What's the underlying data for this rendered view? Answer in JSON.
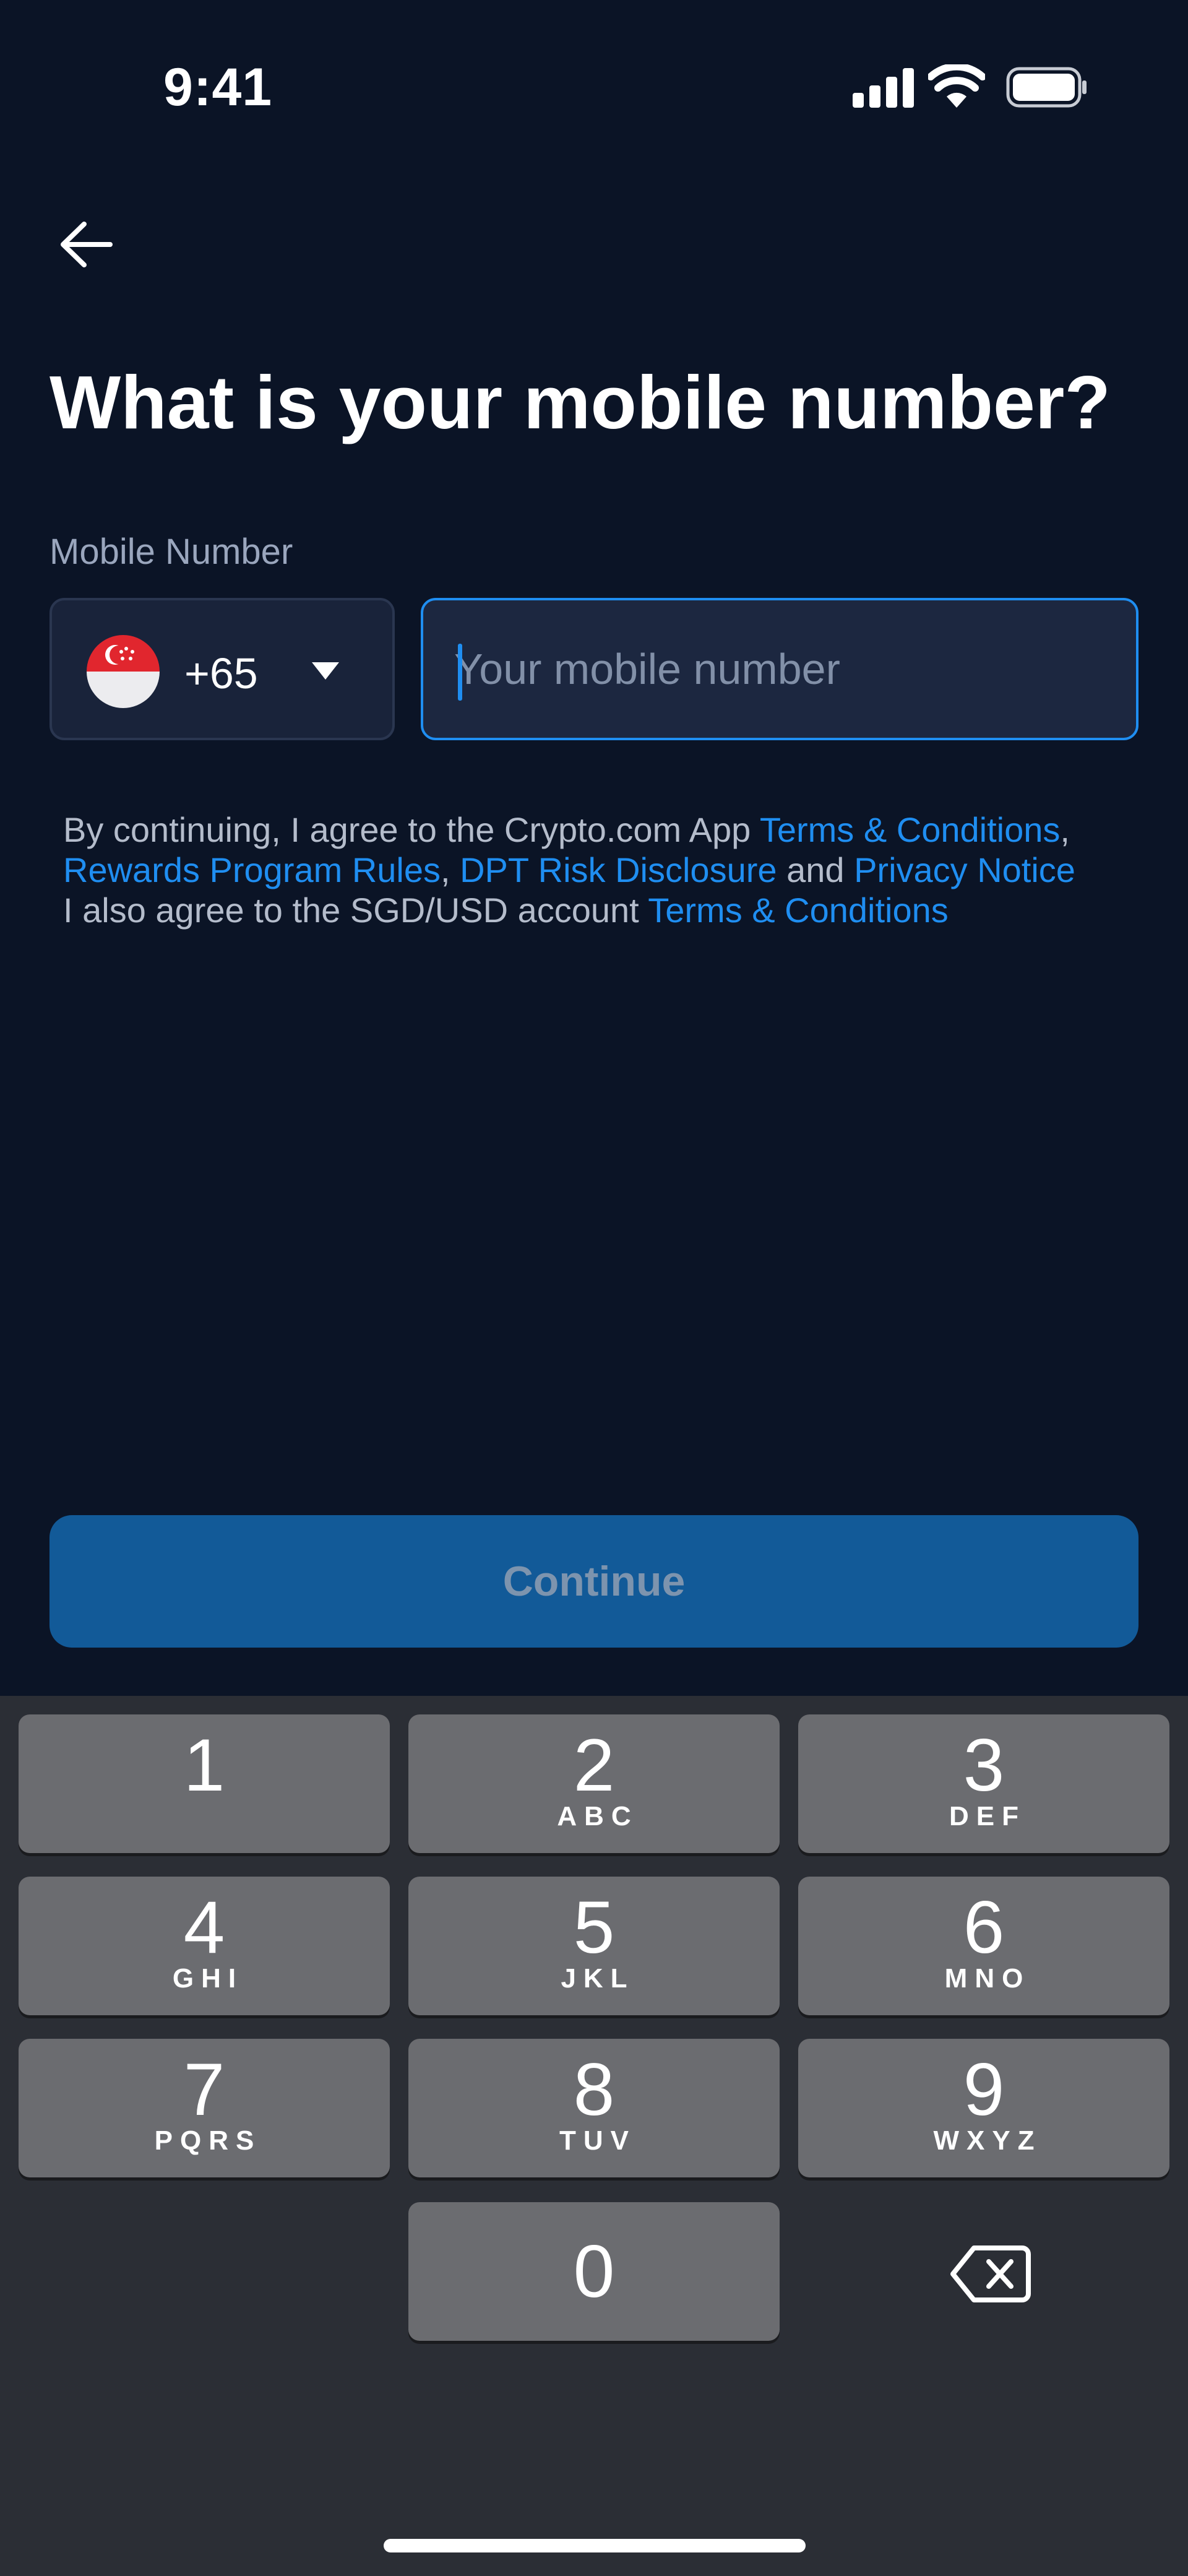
{
  "status_bar": {
    "time": "9:41"
  },
  "header": {
    "title": "What is your mobile number?"
  },
  "form": {
    "label": "Mobile Number",
    "country_code": "+65",
    "country_flag": "singapore-flag-icon",
    "phone_placeholder": "Your mobile number",
    "phone_value": ""
  },
  "terms": {
    "line1_prefix": "By continuing, I agree to the Crypto.com App ",
    "link_terms": "Terms & Conditions",
    "comma1": ",",
    "link_rewards": "Rewards Program Rules",
    "comma2": ", ",
    "link_dpt": "DPT Risk Disclosure",
    "and": " and ",
    "link_privacy": "Privacy Notice",
    "line3_prefix": "I also agree to the SGD/USD account ",
    "link_sgd_terms": "Terms & Conditions"
  },
  "actions": {
    "continue_label": "Continue"
  },
  "keyboard": {
    "keys": [
      {
        "digit": "1",
        "letters": ""
      },
      {
        "digit": "2",
        "letters": "ABC"
      },
      {
        "digit": "3",
        "letters": "DEF"
      },
      {
        "digit": "4",
        "letters": "GHI"
      },
      {
        "digit": "5",
        "letters": "JKL"
      },
      {
        "digit": "6",
        "letters": "MNO"
      },
      {
        "digit": "7",
        "letters": "PQRS"
      },
      {
        "digit": "8",
        "letters": "TUV"
      },
      {
        "digit": "9",
        "letters": "WXYZ"
      },
      {
        "digit": "0",
        "letters": ""
      }
    ],
    "delete_icon": "delete-backspace-icon"
  },
  "colors": {
    "background": "#0b1426",
    "accent": "#1f8ef1",
    "button": "#125a98",
    "keyboard": "#2b2e35",
    "key": "#6b6c70"
  }
}
